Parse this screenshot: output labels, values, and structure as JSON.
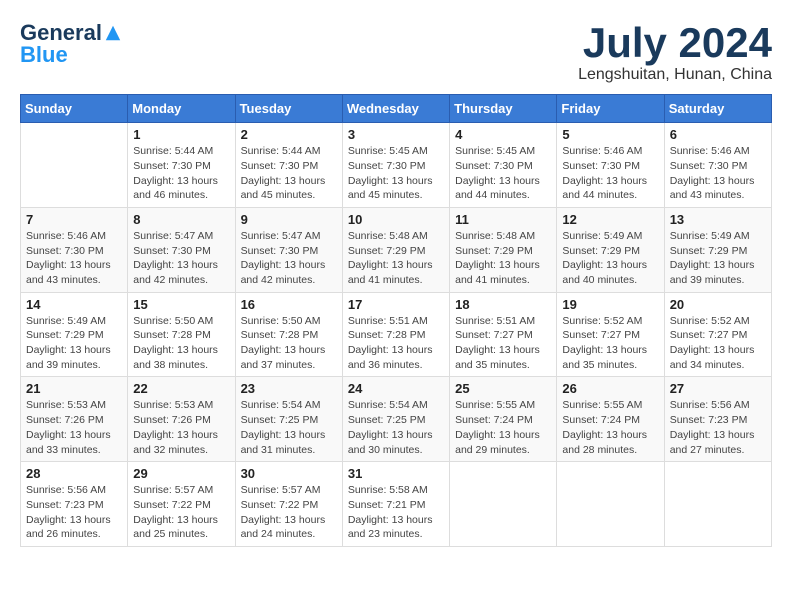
{
  "header": {
    "logo": {
      "general": "General",
      "blue": "Blue"
    },
    "title": "July 2024",
    "location": "Lengshuitan, Hunan, China"
  },
  "calendar": {
    "columns": [
      "Sunday",
      "Monday",
      "Tuesday",
      "Wednesday",
      "Thursday",
      "Friday",
      "Saturday"
    ],
    "weeks": [
      [
        {
          "day": "",
          "info": ""
        },
        {
          "day": "1",
          "info": "Sunrise: 5:44 AM\nSunset: 7:30 PM\nDaylight: 13 hours\nand 46 minutes."
        },
        {
          "day": "2",
          "info": "Sunrise: 5:44 AM\nSunset: 7:30 PM\nDaylight: 13 hours\nand 45 minutes."
        },
        {
          "day": "3",
          "info": "Sunrise: 5:45 AM\nSunset: 7:30 PM\nDaylight: 13 hours\nand 45 minutes."
        },
        {
          "day": "4",
          "info": "Sunrise: 5:45 AM\nSunset: 7:30 PM\nDaylight: 13 hours\nand 44 minutes."
        },
        {
          "day": "5",
          "info": "Sunrise: 5:46 AM\nSunset: 7:30 PM\nDaylight: 13 hours\nand 44 minutes."
        },
        {
          "day": "6",
          "info": "Sunrise: 5:46 AM\nSunset: 7:30 PM\nDaylight: 13 hours\nand 43 minutes."
        }
      ],
      [
        {
          "day": "7",
          "info": "Sunrise: 5:46 AM\nSunset: 7:30 PM\nDaylight: 13 hours\nand 43 minutes."
        },
        {
          "day": "8",
          "info": "Sunrise: 5:47 AM\nSunset: 7:30 PM\nDaylight: 13 hours\nand 42 minutes."
        },
        {
          "day": "9",
          "info": "Sunrise: 5:47 AM\nSunset: 7:30 PM\nDaylight: 13 hours\nand 42 minutes."
        },
        {
          "day": "10",
          "info": "Sunrise: 5:48 AM\nSunset: 7:29 PM\nDaylight: 13 hours\nand 41 minutes."
        },
        {
          "day": "11",
          "info": "Sunrise: 5:48 AM\nSunset: 7:29 PM\nDaylight: 13 hours\nand 41 minutes."
        },
        {
          "day": "12",
          "info": "Sunrise: 5:49 AM\nSunset: 7:29 PM\nDaylight: 13 hours\nand 40 minutes."
        },
        {
          "day": "13",
          "info": "Sunrise: 5:49 AM\nSunset: 7:29 PM\nDaylight: 13 hours\nand 39 minutes."
        }
      ],
      [
        {
          "day": "14",
          "info": "Sunrise: 5:49 AM\nSunset: 7:29 PM\nDaylight: 13 hours\nand 39 minutes."
        },
        {
          "day": "15",
          "info": "Sunrise: 5:50 AM\nSunset: 7:28 PM\nDaylight: 13 hours\nand 38 minutes."
        },
        {
          "day": "16",
          "info": "Sunrise: 5:50 AM\nSunset: 7:28 PM\nDaylight: 13 hours\nand 37 minutes."
        },
        {
          "day": "17",
          "info": "Sunrise: 5:51 AM\nSunset: 7:28 PM\nDaylight: 13 hours\nand 36 minutes."
        },
        {
          "day": "18",
          "info": "Sunrise: 5:51 AM\nSunset: 7:27 PM\nDaylight: 13 hours\nand 35 minutes."
        },
        {
          "day": "19",
          "info": "Sunrise: 5:52 AM\nSunset: 7:27 PM\nDaylight: 13 hours\nand 35 minutes."
        },
        {
          "day": "20",
          "info": "Sunrise: 5:52 AM\nSunset: 7:27 PM\nDaylight: 13 hours\nand 34 minutes."
        }
      ],
      [
        {
          "day": "21",
          "info": "Sunrise: 5:53 AM\nSunset: 7:26 PM\nDaylight: 13 hours\nand 33 minutes."
        },
        {
          "day": "22",
          "info": "Sunrise: 5:53 AM\nSunset: 7:26 PM\nDaylight: 13 hours\nand 32 minutes."
        },
        {
          "day": "23",
          "info": "Sunrise: 5:54 AM\nSunset: 7:25 PM\nDaylight: 13 hours\nand 31 minutes."
        },
        {
          "day": "24",
          "info": "Sunrise: 5:54 AM\nSunset: 7:25 PM\nDaylight: 13 hours\nand 30 minutes."
        },
        {
          "day": "25",
          "info": "Sunrise: 5:55 AM\nSunset: 7:24 PM\nDaylight: 13 hours\nand 29 minutes."
        },
        {
          "day": "26",
          "info": "Sunrise: 5:55 AM\nSunset: 7:24 PM\nDaylight: 13 hours\nand 28 minutes."
        },
        {
          "day": "27",
          "info": "Sunrise: 5:56 AM\nSunset: 7:23 PM\nDaylight: 13 hours\nand 27 minutes."
        }
      ],
      [
        {
          "day": "28",
          "info": "Sunrise: 5:56 AM\nSunset: 7:23 PM\nDaylight: 13 hours\nand 26 minutes."
        },
        {
          "day": "29",
          "info": "Sunrise: 5:57 AM\nSunset: 7:22 PM\nDaylight: 13 hours\nand 25 minutes."
        },
        {
          "day": "30",
          "info": "Sunrise: 5:57 AM\nSunset: 7:22 PM\nDaylight: 13 hours\nand 24 minutes."
        },
        {
          "day": "31",
          "info": "Sunrise: 5:58 AM\nSunset: 7:21 PM\nDaylight: 13 hours\nand 23 minutes."
        },
        {
          "day": "",
          "info": ""
        },
        {
          "day": "",
          "info": ""
        },
        {
          "day": "",
          "info": ""
        }
      ]
    ]
  }
}
